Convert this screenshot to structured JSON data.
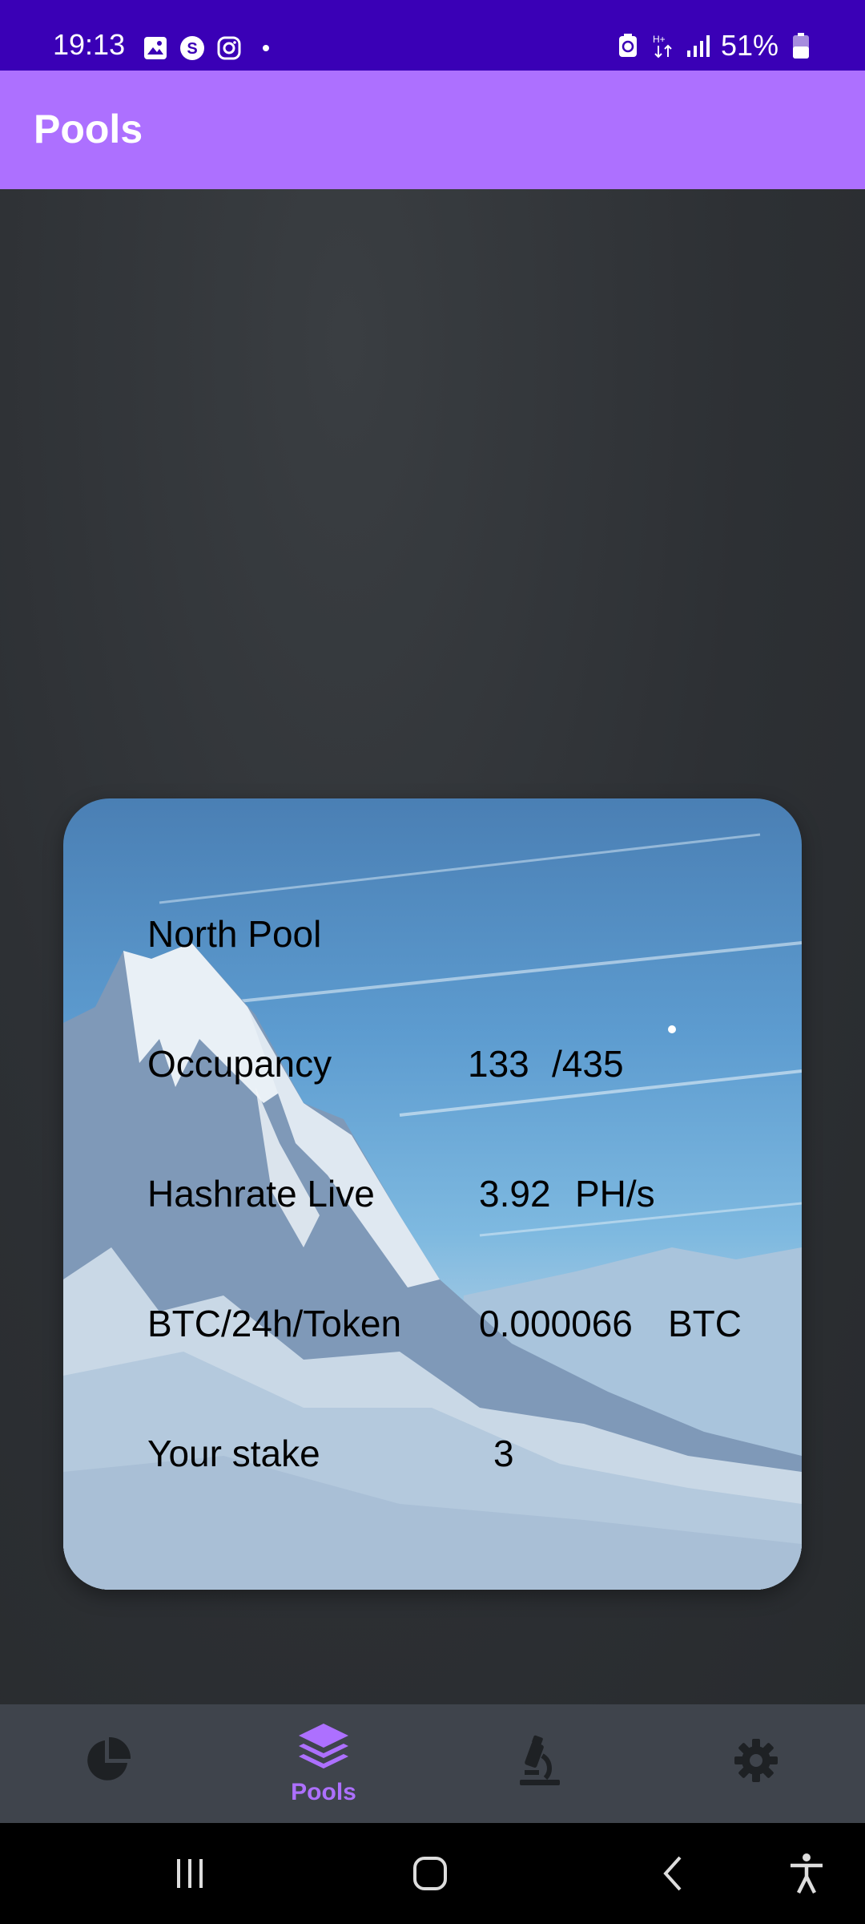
{
  "status_bar": {
    "time": "19:13",
    "battery": "51%",
    "icons_left": [
      "gallery-icon",
      "s-app-icon",
      "instagram-icon",
      "dot-icon"
    ],
    "icons_right": [
      "battery-saver-icon",
      "data-arrows-icon",
      "signal-icon",
      "battery-icon"
    ]
  },
  "app_bar": {
    "title": "Pools"
  },
  "pool_card": {
    "name": "North Pool",
    "rows": [
      {
        "label": "Occupancy",
        "value": "133",
        "unit": "/435"
      },
      {
        "label": "Hashrate Live",
        "value": "3.92",
        "unit": "PH/s"
      },
      {
        "label": "BTC/24h/Token",
        "value": "0.000066",
        "unit": "BTC"
      },
      {
        "label": "Your stake",
        "value": "3",
        "unit": ""
      }
    ]
  },
  "bottom_nav": {
    "items": [
      {
        "icon": "pie-chart-icon",
        "label": "",
        "active": false
      },
      {
        "icon": "layers-icon",
        "label": "Pools",
        "active": true
      },
      {
        "icon": "microscope-icon",
        "label": "",
        "active": false
      },
      {
        "icon": "gear-icon",
        "label": "",
        "active": false
      }
    ],
    "active_color": "#ad70ff",
    "inactive_color": "#1e2124"
  },
  "colors": {
    "status_bar": "#3a00b6",
    "app_bar": "#ad70ff",
    "background": "#2b2f33",
    "bottom_nav": "#3f444c"
  }
}
